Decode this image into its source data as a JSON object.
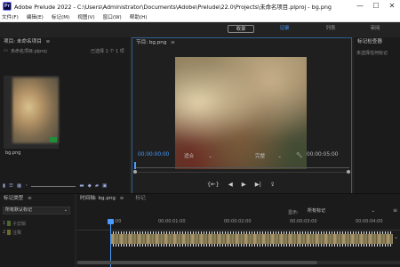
{
  "window": {
    "app_icon_text": "Pr",
    "title": "Adobe Prelude 2022 - C:\\Users\\Administrator\\Documents\\Adobe\\Prelude\\22.0\\Projects\\未命名项目.plproj - bg.png",
    "controls": [
      "—",
      "☐",
      "✕"
    ]
  },
  "menubar": {
    "items": [
      "文件(F)",
      "编辑(E)",
      "标记(M)",
      "视图(V)",
      "窗口(W)",
      "帮助(H)"
    ]
  },
  "workspace": {
    "tabs": [
      "收录",
      "记录",
      "列表",
      "审阅"
    ],
    "active_index": 1
  },
  "project_panel": {
    "title": "项目: 未命名项目",
    "file_name": "未命名项目.plproj",
    "selection_info": "已选择 1 个 1 项",
    "thumbnail_label": "bg.png"
  },
  "monitor_panel": {
    "title": "节目: bg.png",
    "timecode_current": "00:00:00:00",
    "fit_label": "适合",
    "quality_label": "完整",
    "timecode_duration": "00:00:05:00",
    "transport": [
      "{⇤}",
      "◀",
      "▶",
      "▶|",
      "⇪"
    ]
  },
  "metadata_panel": {
    "title": "标记检查器",
    "empty_text": "未选择任何标记"
  },
  "marker_panel": {
    "title": "标记类型",
    "dropdown_value": "所有默认标记",
    "items": [
      {
        "num": "1",
        "label": "子剪辑",
        "color": "#4b6a2a"
      },
      {
        "num": "2",
        "label": "注释",
        "color": "#6a6a2a"
      }
    ]
  },
  "timeline_panel": {
    "title": "时间轴: bg.png",
    "tab2": "标记",
    "display_label": "显示:",
    "display_value": "所有标记",
    "ruler_labels": [
      "00:00",
      "00:00:01:00",
      "00:00:02:00",
      "00:00:03:00",
      "00:00:04:00"
    ]
  },
  "colors": {
    "accent": "#4b9cff",
    "panel_bg": "#1b1b1b",
    "monitor_border": "#2f5f8f"
  }
}
